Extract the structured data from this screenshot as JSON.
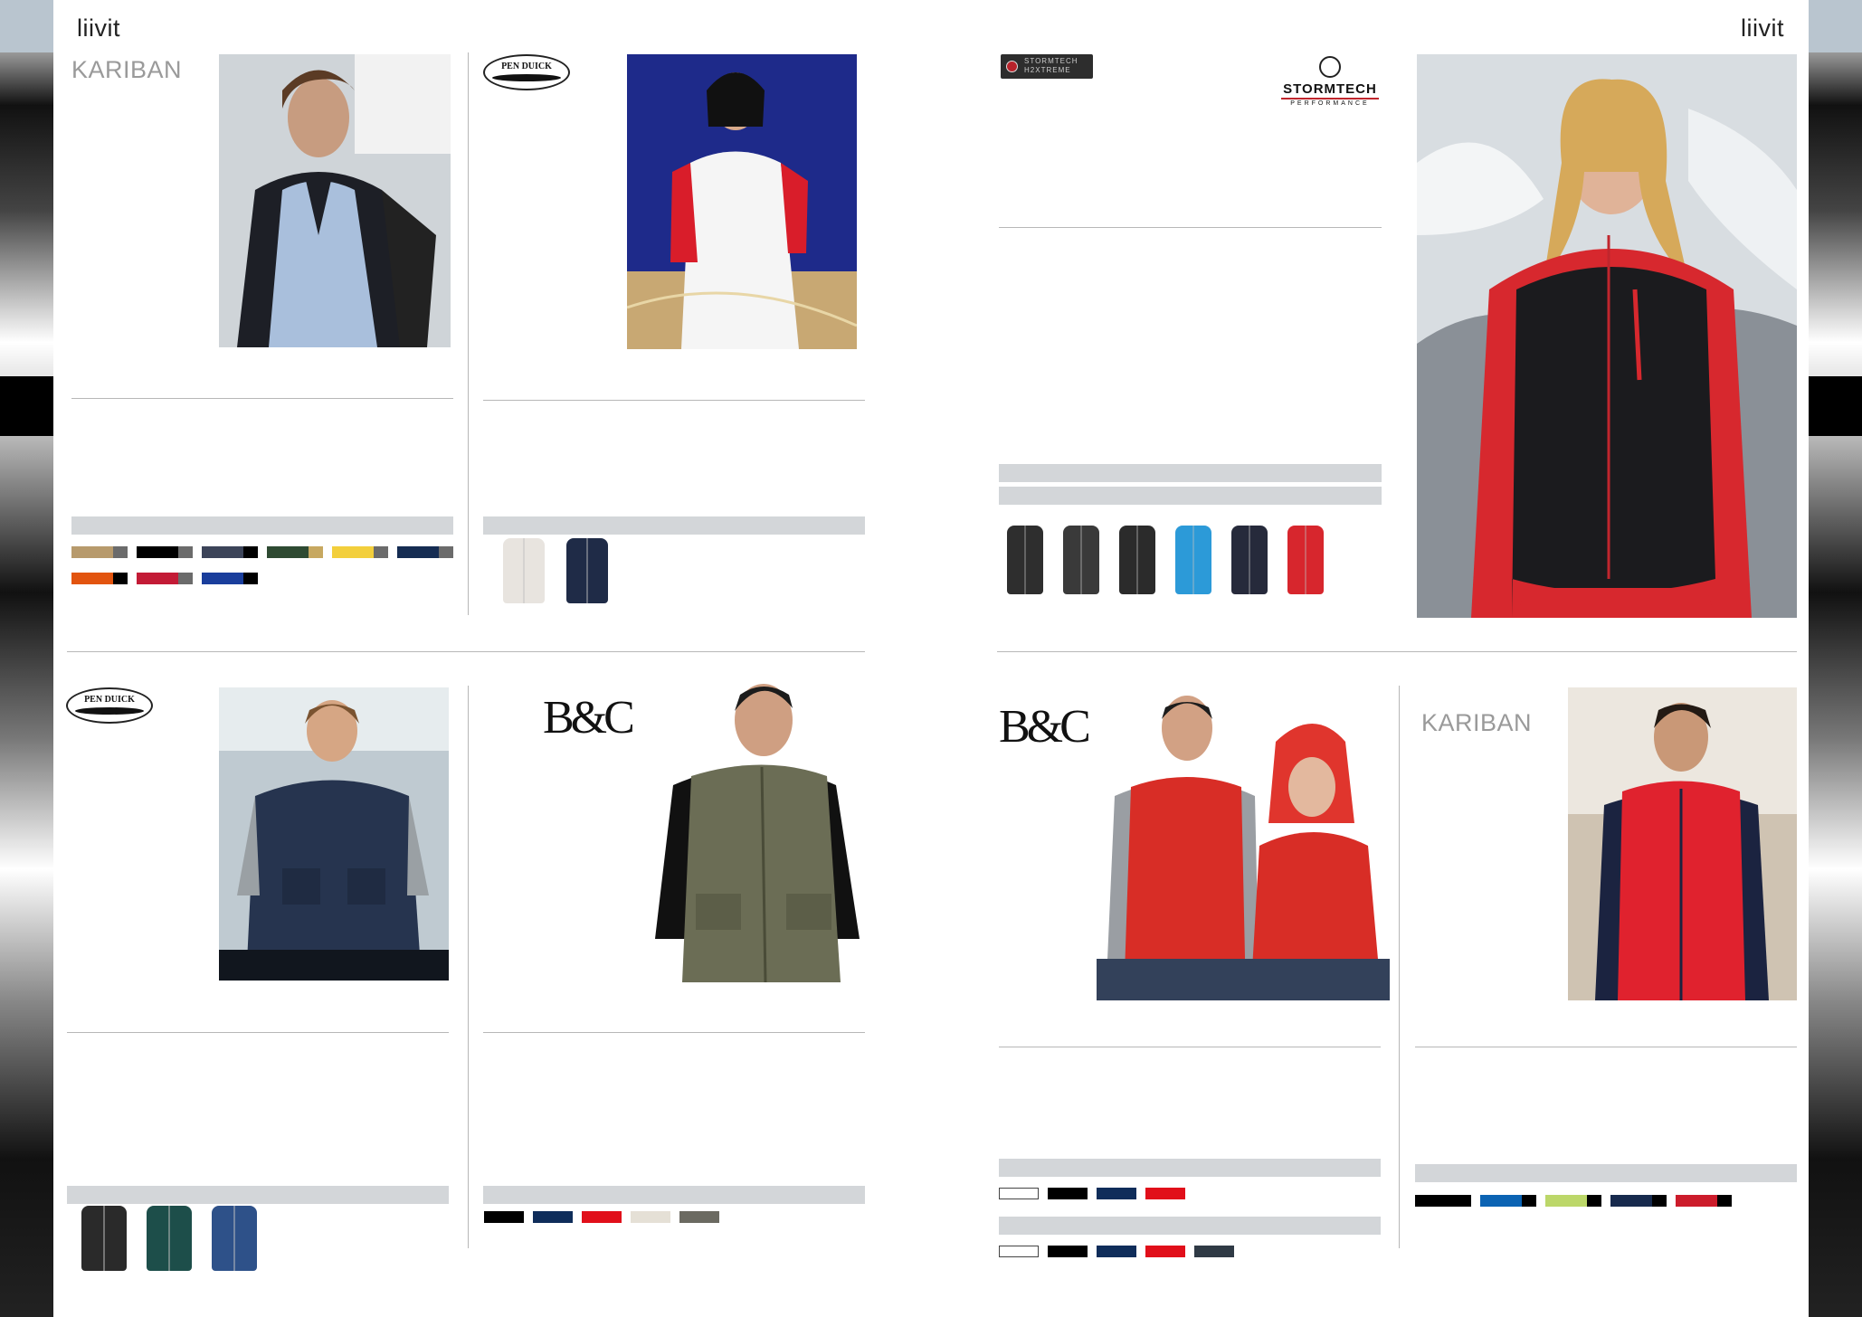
{
  "header": {
    "left_title": "liivit",
    "right_title": "liivit"
  },
  "brands": {
    "kariban": "KARIBAN",
    "pen_duick": "PEN DUICK",
    "bc": "B&C",
    "stormtech": "STORMTECH",
    "stormtech_sub": "PERFORMANCE",
    "stormtech_badge": "STORMTECH H2XTREME"
  },
  "products": [
    {
      "id": "kariban-top-left",
      "brand": "KARIBAN",
      "swatches": [
        "#b79a6c",
        "#000000",
        "#3c4459",
        "#2e4a32",
        "#f3cf3c",
        "#152c52",
        "#e2540f",
        "#c31b36",
        "#1a3e9c"
      ]
    },
    {
      "id": "penduick-top-mid",
      "brand": "PEN DUICK",
      "thumb_colors": [
        "#e8e4df",
        "#1f2b47"
      ]
    },
    {
      "id": "stormtech-top-right",
      "brand": "STORMTECH",
      "thumb_colors": [
        "#2e2e2e",
        "#3a3a3a",
        "#2b2b2b",
        "#2c9ad8",
        "#262a3b",
        "#d7262d"
      ]
    },
    {
      "id": "penduick-bottom-left",
      "brand": "PEN DUICK",
      "thumb_colors": [
        "#2a2a2a",
        "#1d4e4a",
        "#2e5189"
      ]
    },
    {
      "id": "bc-bottom-mid",
      "brand": "B&C",
      "swatches": [
        "#000000",
        "#0f2d5a",
        "#e10f1a",
        "#e5e0d6",
        "#6b6a61"
      ]
    },
    {
      "id": "bc-bottom-right",
      "brand": "B&C",
      "swatches_row1": [
        "#ffffff",
        "#000000",
        "#0f2d5a",
        "#e10f1a"
      ],
      "swatches_row2": [
        "#ffffff",
        "#000000",
        "#0f2d5a",
        "#e10f1a",
        "#2f3a45"
      ]
    },
    {
      "id": "kariban-bottom-far-right",
      "brand": "KARIBAN",
      "swatches": [
        "#000000",
        "#0b63b3",
        "#bcd769",
        "#172a4d",
        "#cc1c2b"
      ]
    }
  ]
}
